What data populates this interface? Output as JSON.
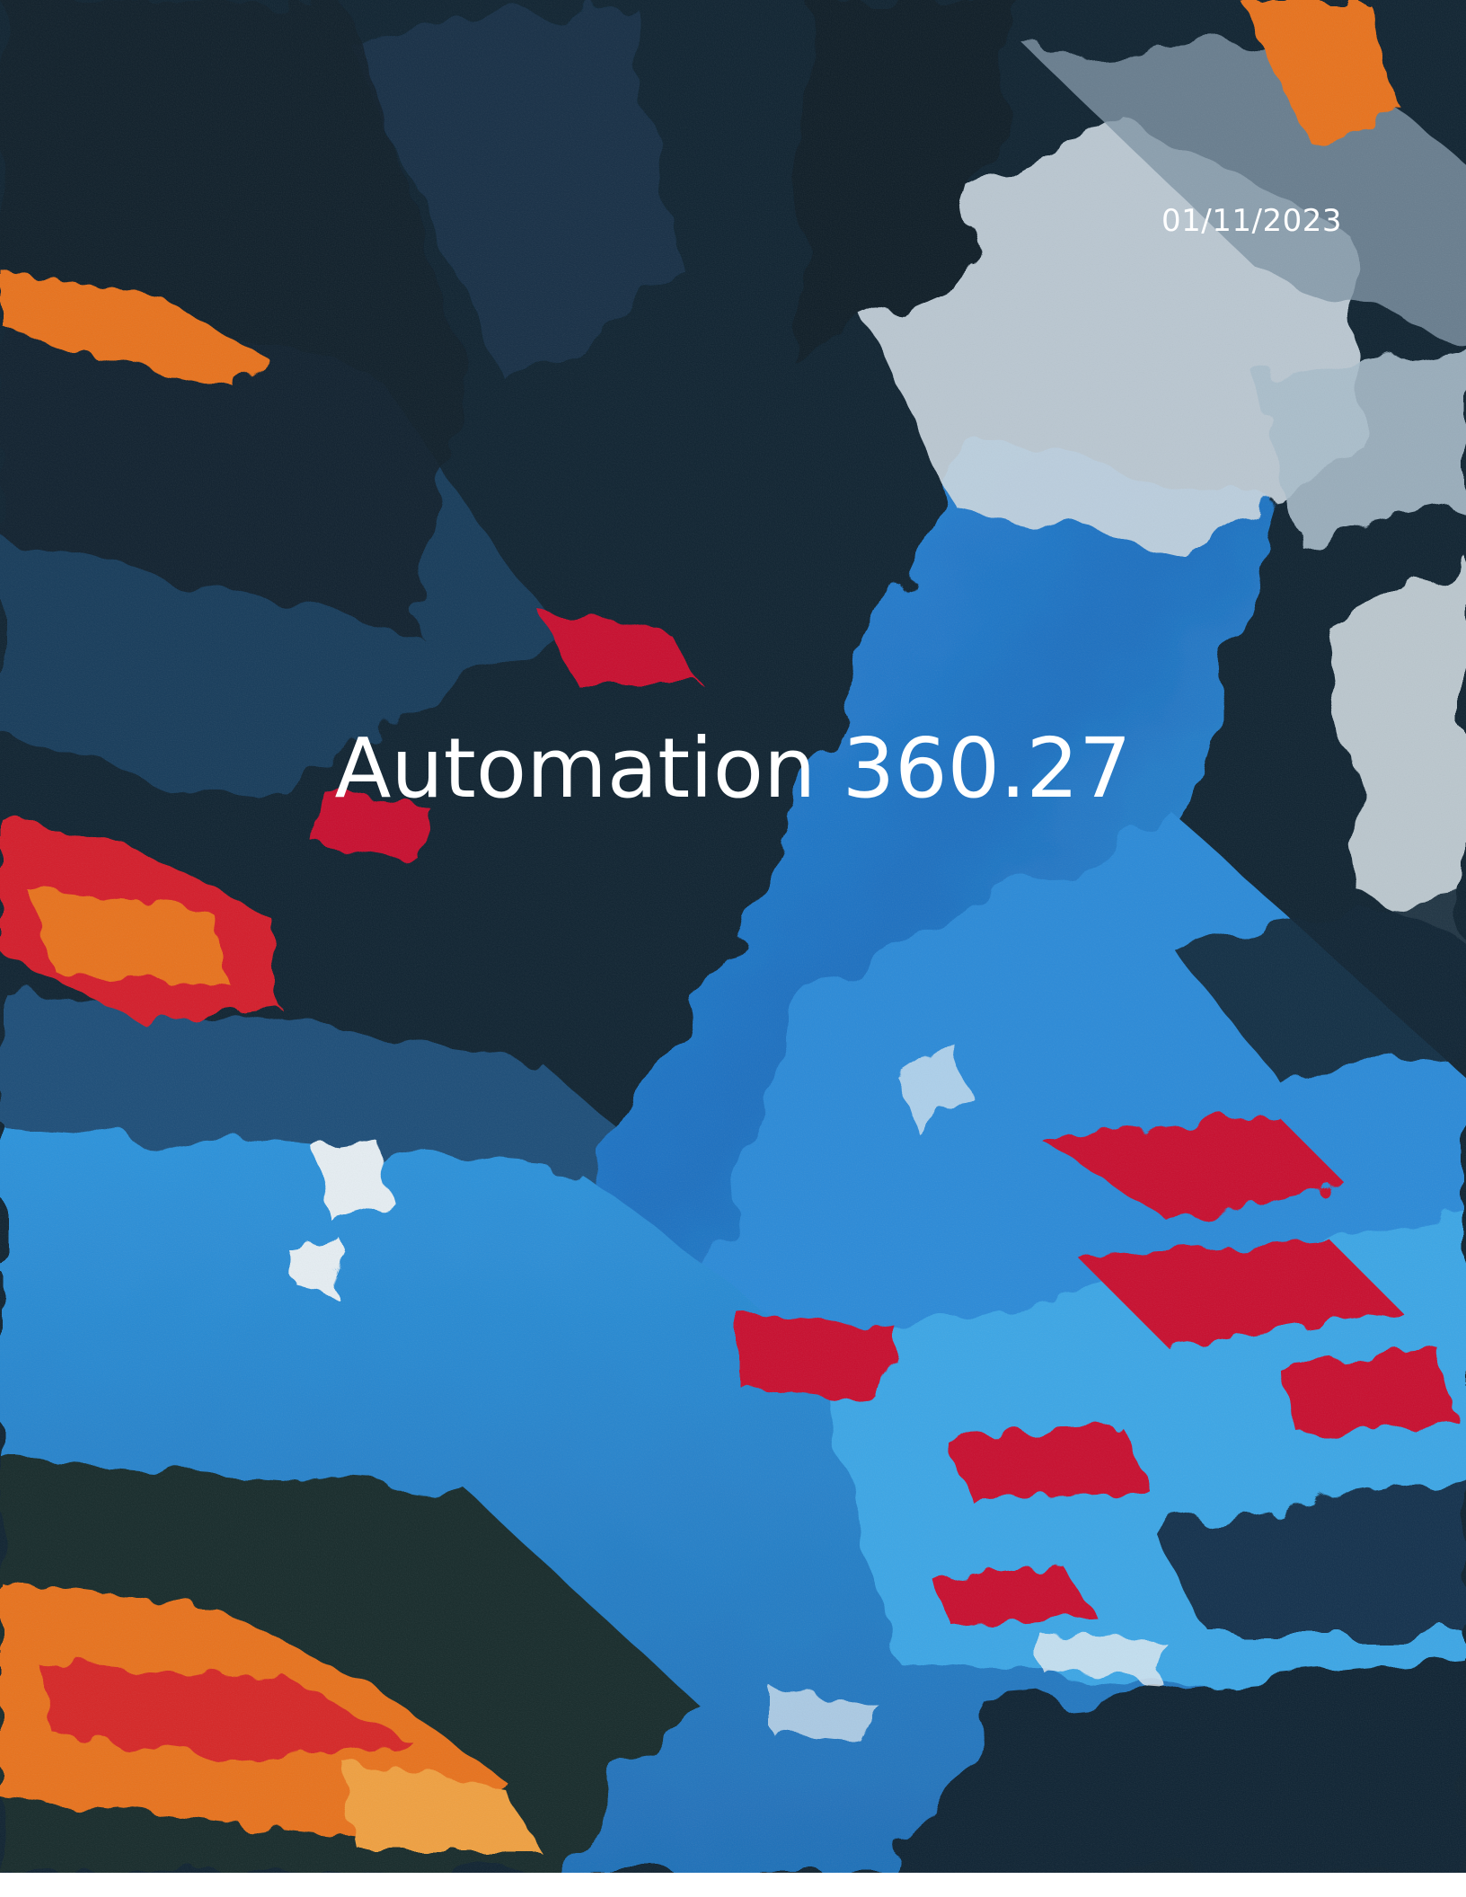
{
  "cover": {
    "date": "01/11/2023",
    "title": "Automation 360.27"
  },
  "colors": {
    "dark_navy": "#0e2230",
    "bright_blue": "#1f7fd0",
    "light_blue": "#3aa0e0",
    "red": "#c8102e",
    "orange": "#e8721c",
    "white_paint": "#dfe8ee",
    "text": "#ffffff"
  }
}
